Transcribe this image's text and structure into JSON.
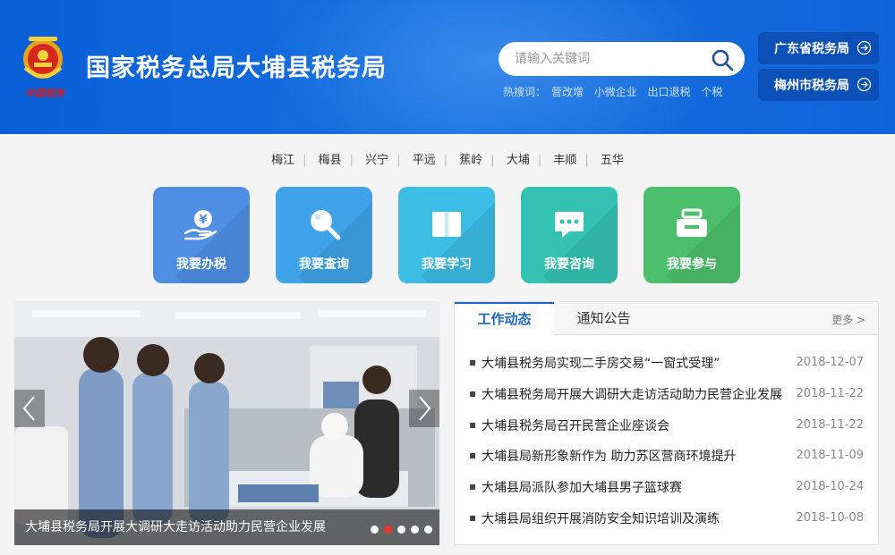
{
  "header": {
    "emblem_text": "中国税务",
    "title": "国家税务总局大埔县税务局",
    "search_placeholder": "请输入关键词",
    "hot_label": "热搜词：",
    "hot_words": [
      "营改增",
      "小微企业",
      "出口退税",
      "个税"
    ],
    "links": [
      "广东省税务局",
      "梅州市税务局"
    ]
  },
  "regions": [
    "梅江",
    "梅县",
    "兴宁",
    "平远",
    "蕉岭",
    "大埔",
    "丰顺",
    "五华"
  ],
  "services": [
    {
      "label": "我要办税",
      "color": "#4e8fe3",
      "icon": "yuan-hand-icon"
    },
    {
      "label": "我要查询",
      "color": "#3ea3e8",
      "icon": "magnifier-icon"
    },
    {
      "label": "我要学习",
      "color": "#3bbde6",
      "icon": "book-icon"
    },
    {
      "label": "我要咨询",
      "color": "#34c3b2",
      "icon": "chat-icon"
    },
    {
      "label": "我要参与",
      "color": "#4cbf6c",
      "icon": "basket-icon"
    }
  ],
  "slider": {
    "caption": "大埔县税务局开展大调研大走访活动助力民营企业发展",
    "slide_count": 5,
    "active_index": 1
  },
  "news": {
    "tabs": [
      "工作动态",
      "通知公告"
    ],
    "more": "更多 >",
    "items": [
      {
        "title": "大埔县税务局实现二手房交易“一窗式受理”",
        "date": "2018-12-07"
      },
      {
        "title": "大埔县税务局开展大调研大走访活动助力民营企业发展",
        "date": "2018-11-22"
      },
      {
        "title": "大埔县税务局召开民营企业座谈会",
        "date": "2018-11-22"
      },
      {
        "title": "大埔县局新形象新作为 助力苏区营商环境提升",
        "date": "2018-11-09"
      },
      {
        "title": "大埔县局派队参加大埔县男子篮球赛",
        "date": "2018-10-24"
      },
      {
        "title": "大埔县局组织开展消防安全知识培训及演练",
        "date": "2018-10-08"
      }
    ]
  }
}
